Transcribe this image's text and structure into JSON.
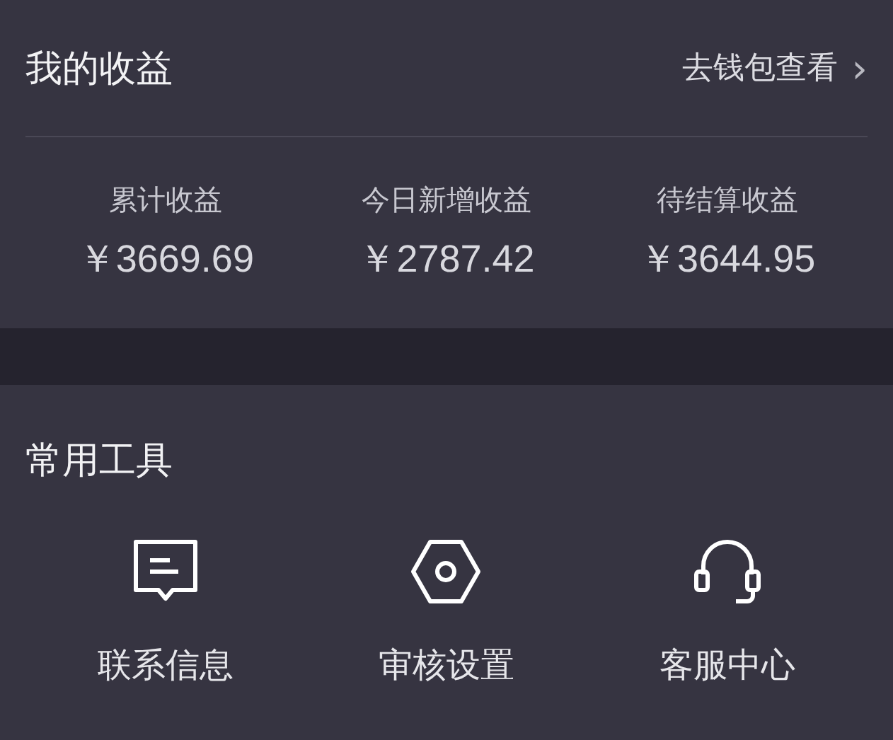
{
  "earnings": {
    "title": "我的收益",
    "link": {
      "label": "去钱包查看",
      "chevron": "›"
    },
    "stats": [
      {
        "label": "累计收益",
        "value": "￥3669.69"
      },
      {
        "label": "今日新增收益",
        "value": "￥2787.42"
      },
      {
        "label": "待结算收益",
        "value": "￥3644.95"
      }
    ]
  },
  "tools": {
    "title": "常用工具",
    "items": [
      {
        "kind": "message",
        "label": "联系信息"
      },
      {
        "kind": "hexagon",
        "label": "审核设置"
      },
      {
        "kind": "headset",
        "label": "客服中心"
      }
    ]
  }
}
